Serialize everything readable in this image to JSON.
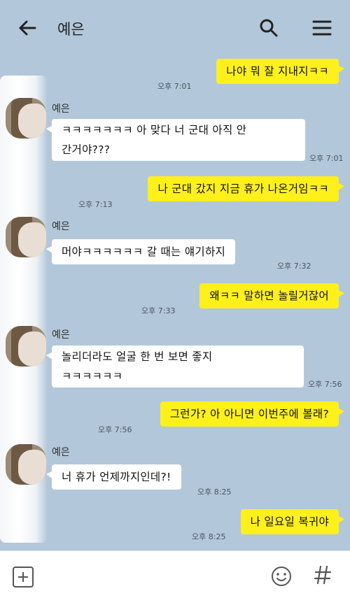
{
  "header": {
    "title": "예은"
  },
  "messages": [
    {
      "from": "me",
      "text": "나야 뭐 잘 지내지ㅋㅋ",
      "time": "오후 7:01"
    },
    {
      "from": "you",
      "sender": "예은",
      "text": "ㅋㅋㅋㅋㅋㅋㅋ 아 맞다 너 군대 아직 안 간거야???",
      "line1": "ㅋㅋㅋㅋㅋㅋㅋ 아 맞다 너 군대 아직 안",
      "line2": "간거야???",
      "time": "오후 7:01"
    },
    {
      "from": "me",
      "text": "나 군대 갔지 지금 휴가 나온거임ㅋㅋ",
      "time": "오후 7:13"
    },
    {
      "from": "you",
      "sender": "예은",
      "text": "머야ㅋㅋㅋㅋㅋㅋ 갈 때는 얘기하지",
      "time": "오후 7:32"
    },
    {
      "from": "me",
      "text": "왜ㅋㅋ 말하면 놀릴거잖어",
      "time": "오후 7:33"
    },
    {
      "from": "you",
      "sender": "예은",
      "line1": "놀리더라도 얼굴 한 번 보면 좋지",
      "line2": "ㅋㅋㅋㅋㅋㅋ",
      "time": "오후 7:56"
    },
    {
      "from": "me",
      "text": "그런가? 아 아니면 이번주에 볼래?",
      "time": "오후 7:56"
    },
    {
      "from": "you",
      "sender": "예은",
      "text": "너 휴가 언제까지인데?!",
      "time": "오후 8:25"
    },
    {
      "from": "me",
      "text": "나 일요일 복귀야",
      "time": "오후 8:25"
    }
  ],
  "icons": {
    "back": "arrow-left-icon",
    "search": "search-icon",
    "menu": "hamburger-menu-icon",
    "attach": "plus-square-icon",
    "emoji": "emoticon-icon",
    "hash": "hash-icon"
  },
  "colors": {
    "background": "#b2c7d9",
    "my_bubble": "#fef01b",
    "their_bubble": "#ffffff"
  }
}
